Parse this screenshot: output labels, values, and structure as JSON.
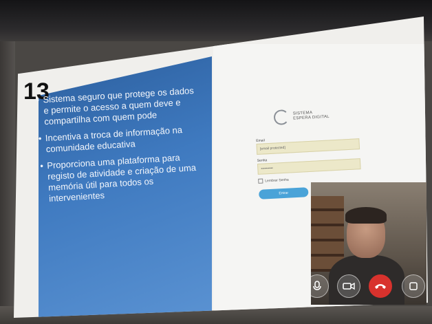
{
  "slide": {
    "number": "13",
    "bullets": [
      "Sistema seguro que protege os dados e permite o acesso a quem deve e compartilha com quem pode",
      "Incentiva a troca de informação na comunidade educativa",
      "Proporciona uma plataforma para registo de atividade e criação de uma memória útil para todos os intervenientes"
    ]
  },
  "login": {
    "brand_line1": "SISTEMA",
    "brand_line2": "ESPERA DIGITAL",
    "email_label": "Email",
    "email_value": "[email protected]",
    "password_label": "Senha",
    "password_value": "••••••••••",
    "remember_label": "Lembrar Senha",
    "enter_label": "Entrar"
  },
  "video_call": {
    "icons": [
      "microphone-icon",
      "camera-icon",
      "hang-up-icon",
      "more-icon"
    ],
    "hangup_color": "#d8322d"
  }
}
